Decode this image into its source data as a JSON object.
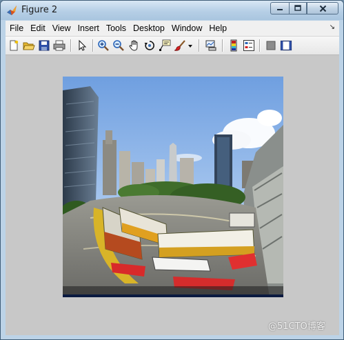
{
  "window": {
    "title": "Figure 2",
    "controls": [
      "minimize",
      "maximize",
      "close"
    ]
  },
  "menubar": {
    "items": [
      "File",
      "Edit",
      "View",
      "Insert",
      "Tools",
      "Desktop",
      "Window",
      "Help"
    ],
    "overflow_arrow": "↘"
  },
  "toolbar": {
    "buttons": [
      "new-figure-icon",
      "open-file-icon",
      "save-icon",
      "print-icon",
      "edit-plot-arrow-icon",
      "zoom-in-icon",
      "zoom-out-icon",
      "pan-hand-icon",
      "rotate-3d-icon",
      "data-cursor-icon",
      "brush-icon",
      "brush-dropdown-icon",
      "link-plot-icon",
      "colorbar-icon",
      "legend-icon",
      "hide-plot-tools-icon",
      "show-plot-tools-icon"
    ]
  },
  "figure": {
    "background_color": "#c8c8c8",
    "image_content": "fisheye-street-scene"
  },
  "watermark": {
    "text": "@51CTO博客"
  }
}
